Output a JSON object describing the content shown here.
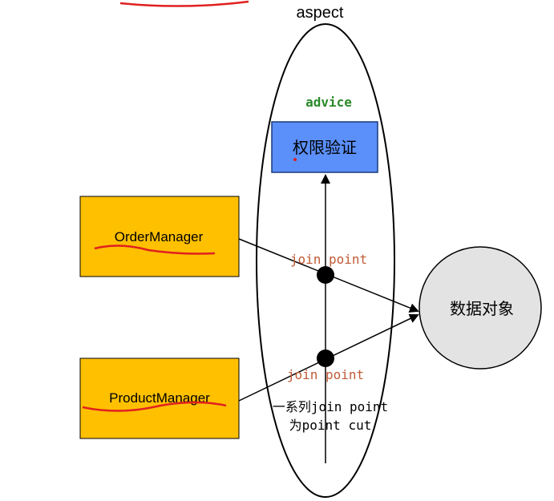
{
  "aspect_label": "aspect",
  "advice_label": "advice",
  "advice_box_text": "权限验证",
  "order_manager_label": "OrderManager",
  "product_manager_label": "ProductManager",
  "join_point_top_label": "join point",
  "join_point_bottom_label": "join point",
  "data_object_label": "数据对象",
  "pointcut_line1": "一系列join point",
  "pointcut_line2": "为point cut",
  "colors": {
    "manager_fill": "#ffc000",
    "advice_fill": "#5b8ff9",
    "data_object_fill": "#e3e3e3",
    "advice_text": "#2a8a2a",
    "join_point_text": "#c05a36",
    "underline_red": "#e02020"
  }
}
